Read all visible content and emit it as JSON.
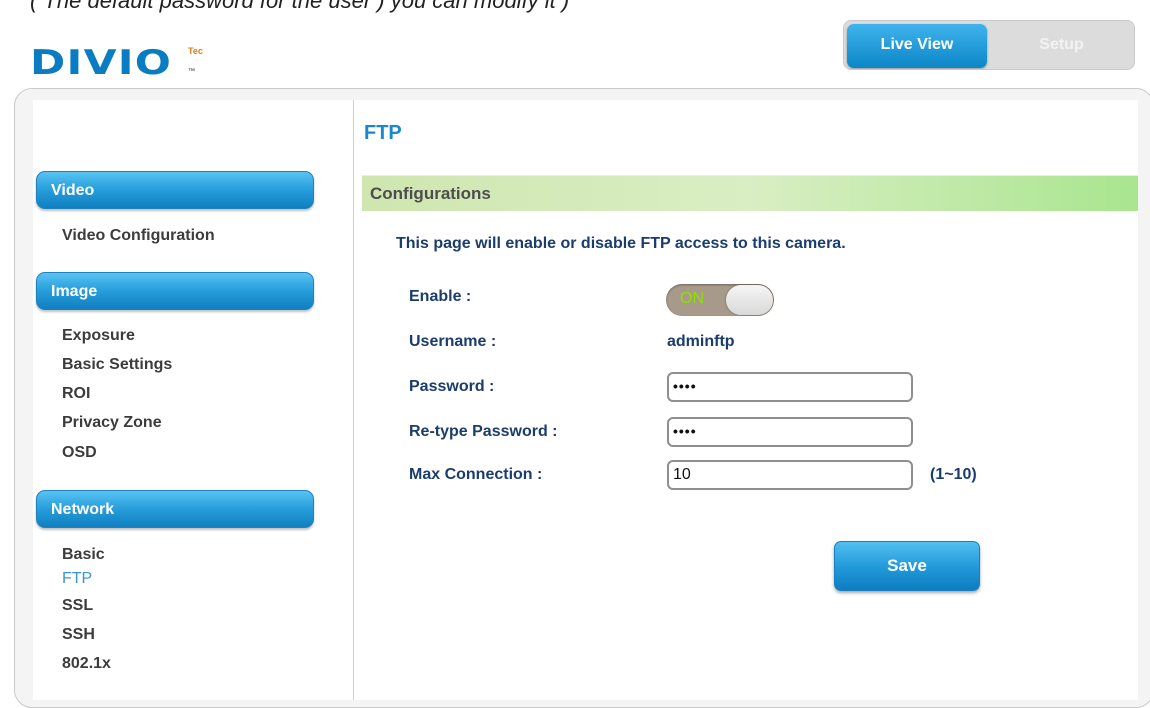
{
  "top_cutoff_text": "( The default password for the user ) you can modify it )",
  "brand": {
    "name": "DIVIO",
    "tec": "Tec",
    "tm": "™"
  },
  "topnav": {
    "live_view": "Live View",
    "setup": "Setup"
  },
  "sidebar": {
    "sections": [
      {
        "title": "Video",
        "items": [
          "Video Configuration"
        ]
      },
      {
        "title": "Image",
        "items": [
          "Exposure",
          "Basic Settings",
          "ROI",
          "Privacy Zone",
          "OSD"
        ]
      },
      {
        "title": "Network",
        "items": [
          "Basic",
          "FTP",
          "SSL",
          "SSH",
          "802.1x"
        ]
      }
    ],
    "active_item": "FTP"
  },
  "page": {
    "title": "FTP",
    "section": "Configurations",
    "description": "This page will enable or disable FTP access to this camera.",
    "fields": {
      "enable_label": "Enable :",
      "enable_state": "ON",
      "username_label": "Username :",
      "username_value": "adminftp",
      "password_label": "Password :",
      "password_value": "••••",
      "retype_label": "Re-type Password :",
      "retype_value": "••••",
      "max_label": "Max Connection :",
      "max_value": "10",
      "max_hint": "(1~10)"
    },
    "save_label": "Save"
  },
  "colors": {
    "accent": "#1888cf",
    "config_bar": "#d9eec3",
    "toggle_on_text": "#8ee000"
  }
}
